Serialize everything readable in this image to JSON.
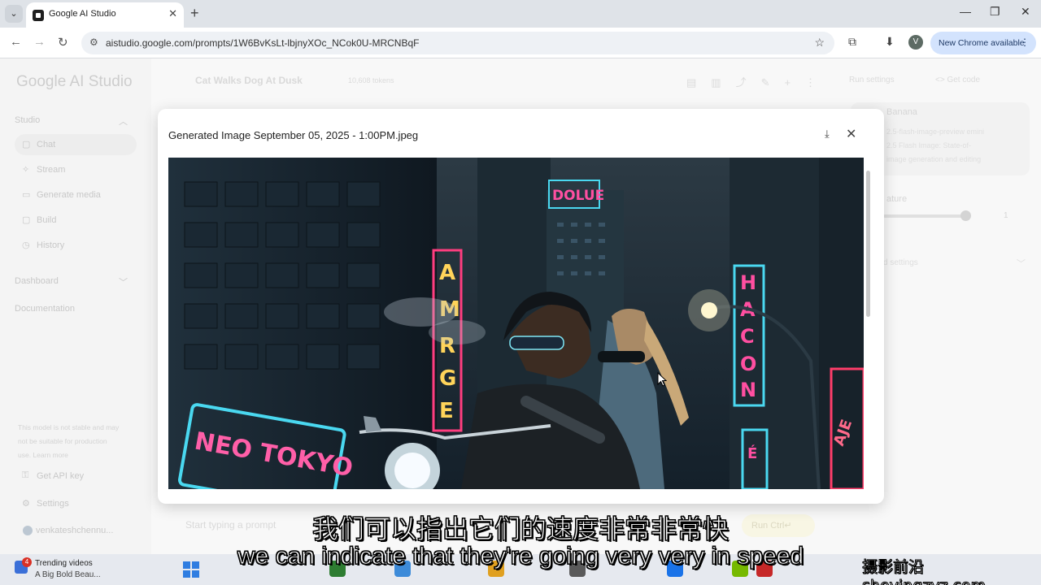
{
  "browser": {
    "tab_title": "Google AI Studio",
    "url": "aistudio.google.com/prompts/1W6BvKsLt-lbjnyXOc_NCok0U-MRCNBqF",
    "profile_initial": "V",
    "update_label": "New Chrome available"
  },
  "sidebar": {
    "logo": "Google AI Studio",
    "studio_label": "Studio",
    "items": [
      {
        "label": "Chat",
        "icon": "chat-icon"
      },
      {
        "label": "Stream",
        "icon": "stream-icon"
      },
      {
        "label": "Generate media",
        "icon": "media-icon"
      },
      {
        "label": "Build",
        "icon": "build-icon"
      },
      {
        "label": "History",
        "icon": "history-icon"
      }
    ],
    "dashboard_label": "Dashboard",
    "documentation_label": "Documentation",
    "note": "This model is not stable and may not be suitable for production use. Learn more",
    "api_key_label": "Get API key",
    "settings_label": "Settings",
    "user_name": "venkateshchennu..."
  },
  "main": {
    "title": "Cat Walks Dog At Dusk",
    "tokens": "10,608 tokens",
    "prompt_placeholder": "Start typing a prompt",
    "run_label": "Run  Ctrl↵"
  },
  "run_settings": {
    "header": "Run settings",
    "get_code": "<> Get code",
    "model_name": "Banana",
    "model_desc": "2.5-flash-image-preview emini 2.5 Flash Image: State-of- image generation and editing",
    "temperature_label": "ature",
    "temperature_value": "1",
    "advanced_label": "d settings"
  },
  "modal": {
    "title": "Generated Image September 05, 2025 - 1:00PM.jpeg",
    "download_icon": "download-icon",
    "close_icon": "close-icon",
    "image": {
      "signs": [
        "DOLUE",
        "AMRGE",
        "HACON",
        "NEO TOKYO",
        "ÉIO",
        "AJE"
      ]
    }
  },
  "subtitles": {
    "cn": "我们可以指出它们的速度非常非常快",
    "en": "we can indicate that they're going very very in speed"
  },
  "taskbar": {
    "badge": "4",
    "trend_title": "Trending videos",
    "trend_sub": "A Big Bold Beau..."
  },
  "watermark": "摄影前沿 sheyingzyz.com"
}
